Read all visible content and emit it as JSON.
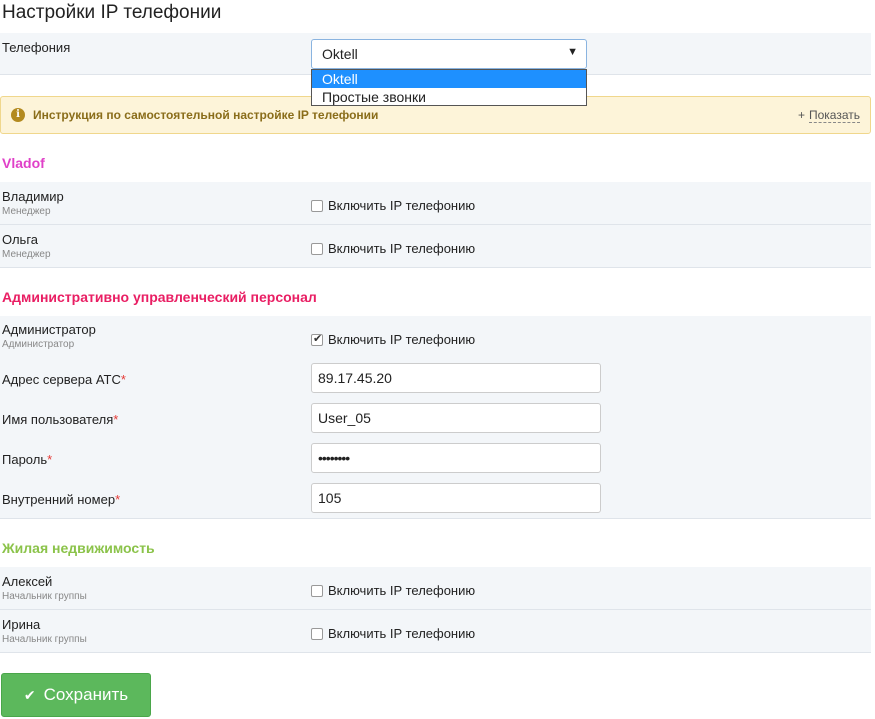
{
  "page_title": "Настройки IP телефонии",
  "telephony": {
    "label": "Телефония",
    "selected": "Oktell",
    "options": [
      "Oktell",
      "Простые звонки"
    ]
  },
  "info": {
    "text": "Инструкция по самостоятельной настройке IP телефонии",
    "plus": "+",
    "show_link": "Показать"
  },
  "enable_label": "Включить IP телефонию",
  "groups": [
    {
      "title": "Vladof",
      "color": "#e040c8",
      "users": [
        {
          "name": "Владимир",
          "role": "Менеджер",
          "enabled": false
        },
        {
          "name": "Ольга",
          "role": "Менеджер",
          "enabled": false
        }
      ]
    },
    {
      "title": "Административно управленческий персонал",
      "color": "#e91e63",
      "users": [
        {
          "name": "Администратор",
          "role": "Администратор",
          "enabled": true
        }
      ]
    },
    {
      "title": "Жилая недвижимость",
      "color": "#8bc34a",
      "users": [
        {
          "name": "Алексей",
          "role": "Начальник группы",
          "enabled": false
        },
        {
          "name": "Ирина",
          "role": "Начальник группы",
          "enabled": false
        }
      ]
    }
  ],
  "admin_form": {
    "server_label": "Адрес сервера АТС",
    "server_value": "89.17.45.20",
    "user_label": "Имя пользователя",
    "user_value": "User_05",
    "password_label": "Пароль",
    "password_value": "••••••••",
    "ext_label": "Внутренний номер",
    "ext_value": "105",
    "required_mark": "*"
  },
  "save_label": "Сохранить",
  "icons": {
    "info": "info-icon",
    "select_arrow": "caret-down-icon",
    "save": "checkmark-icon"
  }
}
